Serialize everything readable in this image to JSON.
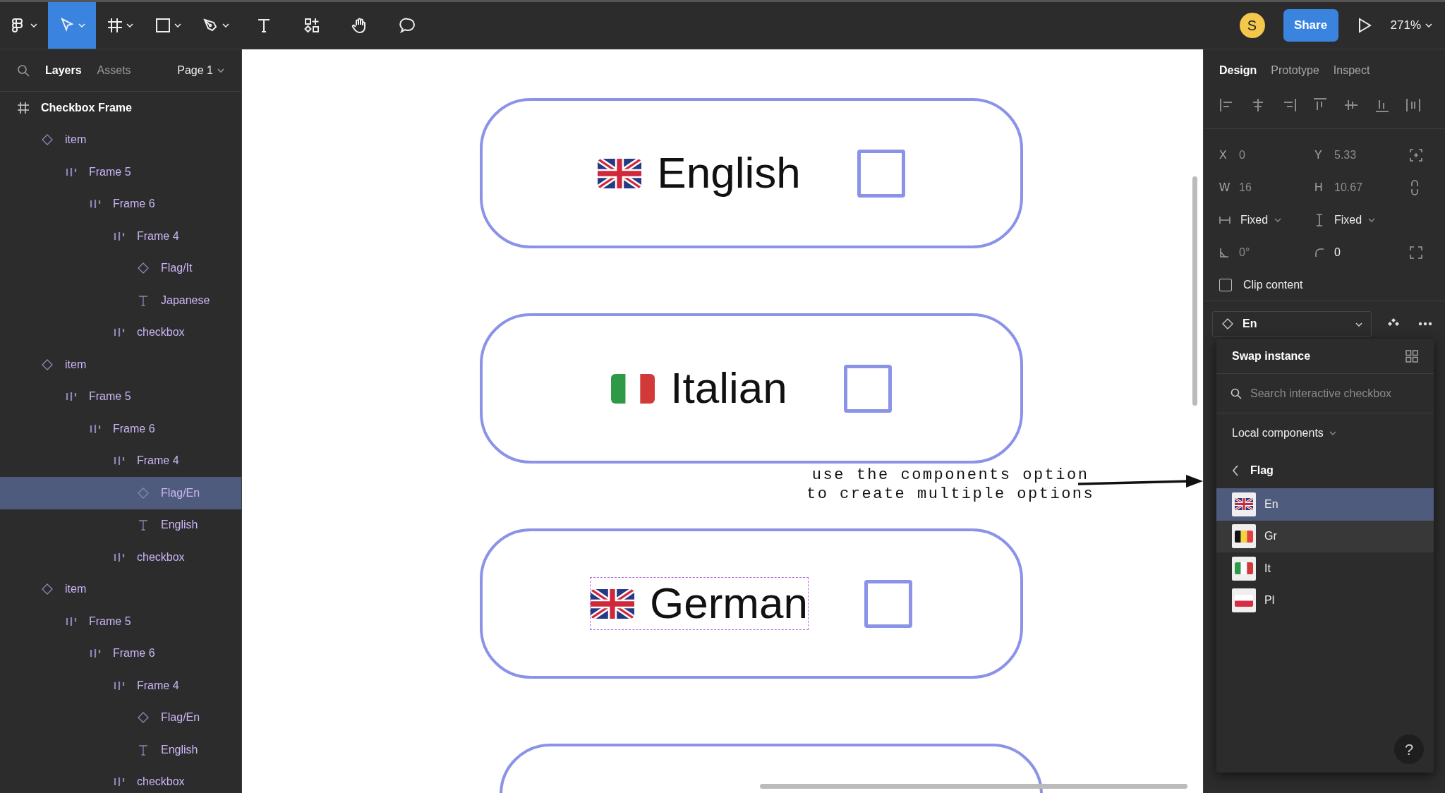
{
  "toolbar": {
    "tools": [
      {
        "kind": "main-menu",
        "selected": false
      },
      {
        "kind": "move",
        "selected": true
      },
      {
        "kind": "frame",
        "selected": false
      },
      {
        "kind": "shape",
        "selected": false
      },
      {
        "kind": "pen",
        "selected": false
      },
      {
        "kind": "text",
        "selected": false
      },
      {
        "kind": "resources",
        "selected": false
      },
      {
        "kind": "hand",
        "selected": false
      },
      {
        "kind": "comment",
        "selected": false
      }
    ],
    "avatar": "S",
    "share": "Share",
    "zoom": "271%"
  },
  "layers_panel": {
    "tabs": [
      {
        "label": "Layers",
        "selected": true
      },
      {
        "label": "Assets",
        "selected": false
      }
    ],
    "page": "Page 1",
    "tree": [
      {
        "name": "Checkbox Frame",
        "kind": "frame",
        "selected": false,
        "children": [
          {
            "name": "item",
            "kind": "component",
            "selected": false,
            "children": [
              {
                "name": "Frame 5",
                "kind": "autolayout",
                "selected": false,
                "children": [
                  {
                    "name": "Frame 6",
                    "kind": "autolayout",
                    "selected": false,
                    "children": [
                      {
                        "name": "Frame 4",
                        "kind": "autolayout",
                        "selected": false,
                        "children": [
                          {
                            "name": "Flag/It",
                            "kind": "component",
                            "selected": false
                          },
                          {
                            "name": "Japanese",
                            "kind": "text",
                            "selected": false
                          }
                        ]
                      },
                      {
                        "name": "checkbox",
                        "kind": "autolayout",
                        "selected": false
                      }
                    ]
                  }
                ]
              }
            ]
          },
          {
            "name": "item",
            "kind": "component",
            "selected": false,
            "children": [
              {
                "name": "Frame 5",
                "kind": "autolayout",
                "selected": false,
                "children": [
                  {
                    "name": "Frame 6",
                    "kind": "autolayout",
                    "selected": false,
                    "children": [
                      {
                        "name": "Frame 4",
                        "kind": "autolayout",
                        "selected": false,
                        "children": [
                          {
                            "name": "Flag/En",
                            "kind": "component",
                            "selected": true
                          },
                          {
                            "name": "English",
                            "kind": "text",
                            "selected": false
                          }
                        ]
                      },
                      {
                        "name": "checkbox",
                        "kind": "autolayout",
                        "selected": false
                      }
                    ]
                  }
                ]
              }
            ]
          },
          {
            "name": "item",
            "kind": "component",
            "selected": false,
            "children": [
              {
                "name": "Frame 5",
                "kind": "autolayout",
                "selected": false,
                "children": [
                  {
                    "name": "Frame 6",
                    "kind": "autolayout",
                    "selected": false,
                    "children": [
                      {
                        "name": "Frame 4",
                        "kind": "autolayout",
                        "selected": false,
                        "children": [
                          {
                            "name": "Flag/En",
                            "kind": "component",
                            "selected": false
                          },
                          {
                            "name": "English",
                            "kind": "text",
                            "selected": false
                          }
                        ]
                      },
                      {
                        "name": "checkbox",
                        "kind": "autolayout",
                        "selected": false
                      }
                    ]
                  }
                ]
              }
            ]
          }
        ]
      }
    ]
  },
  "canvas": {
    "cards": [
      {
        "kind": "uk",
        "label": "English",
        "checked": false,
        "selected": false
      },
      {
        "kind": "it",
        "label": "Italian",
        "checked": false,
        "selected": false
      },
      {
        "kind": "uk",
        "label": "German",
        "checked": false,
        "selected": true
      },
      {
        "kind": "empty"
      }
    ],
    "annotation": {
      "lines": [
        "use the components option",
        "to create multiple options"
      ]
    }
  },
  "design_panel": {
    "tabs": [
      {
        "label": "Design",
        "selected": true
      },
      {
        "label": "Prototype",
        "selected": false
      },
      {
        "label": "Inspect",
        "selected": false
      }
    ],
    "position": [
      {
        "label": "X",
        "value": "0"
      },
      {
        "label": "Y",
        "value": "5.33"
      }
    ],
    "size": [
      {
        "label": "W",
        "value": "16"
      },
      {
        "label": "H",
        "value": "10.67"
      }
    ],
    "resizing": [
      "Fixed",
      "Fixed"
    ],
    "rotation": "0°",
    "corner_radius": "0",
    "clip_content": {
      "label": "Clip content",
      "checked": false
    },
    "instance": "En"
  },
  "swap_popup": {
    "title": "Swap instance",
    "search": {
      "placeholder": "Search interactive checkbox"
    },
    "library": "Local components",
    "group": "Flag",
    "items": [
      {
        "label": "En",
        "kind": "uk",
        "selected": true,
        "hovered": false
      },
      {
        "label": "Gr",
        "kind": "be",
        "selected": false,
        "hovered": true
      },
      {
        "label": "It",
        "kind": "it",
        "selected": false,
        "hovered": false
      },
      {
        "label": "Pl",
        "kind": "pl",
        "selected": false,
        "hovered": false
      }
    ],
    "help": "?"
  }
}
